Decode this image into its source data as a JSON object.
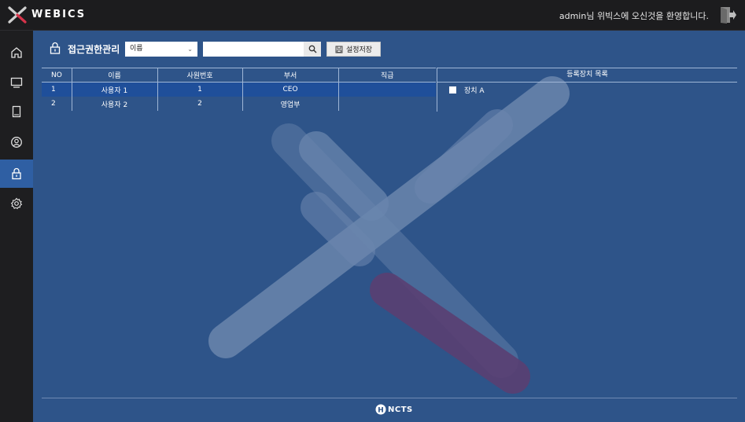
{
  "app": {
    "brand": "WEBICS",
    "welcome": "admin님 위빅스에 오신것을 환영합니다."
  },
  "sidebar": {
    "items": [
      {
        "name": "home",
        "icon": "home-icon"
      },
      {
        "name": "monitor",
        "icon": "monitor-icon"
      },
      {
        "name": "device",
        "icon": "tablet-icon"
      },
      {
        "name": "user",
        "icon": "user-icon"
      },
      {
        "name": "access",
        "icon": "lock-icon",
        "active": true
      },
      {
        "name": "settings",
        "icon": "gear-icon"
      }
    ]
  },
  "toolbar": {
    "title": "접근권한관리",
    "filter_selected": "이름",
    "search_value": "",
    "save_label": "설정저장"
  },
  "table": {
    "headers": [
      "NO",
      "이름",
      "사원번호",
      "부서",
      "직급"
    ],
    "rows": [
      {
        "no": "1",
        "name": "사용자 1",
        "emp": "1",
        "dept": "CEO",
        "rank": "",
        "selected": true
      },
      {
        "no": "2",
        "name": "사용자 2",
        "emp": "2",
        "dept": "영업부",
        "rank": "",
        "selected": false
      }
    ]
  },
  "devices": {
    "header": "등록장치 목록",
    "items": [
      {
        "label": "장치 A",
        "checked": false
      }
    ]
  },
  "footer": {
    "logo_text": "NCTS",
    "logo_badge": "H"
  },
  "colors": {
    "main_bg": "#2e5489",
    "accent": "#2f5fa3",
    "selected_row": "#1f4f9a"
  }
}
